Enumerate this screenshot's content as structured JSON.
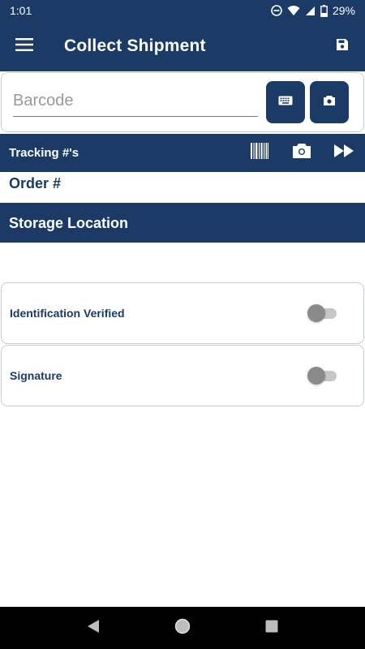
{
  "status_bar": {
    "time": "1:01",
    "battery": "29%",
    "icons": [
      "do-not-disturb-icon",
      "wifi-icon",
      "cell-signal-icon",
      "battery-icon"
    ]
  },
  "app_bar": {
    "title": "Collect Shipment",
    "menu_icon": "hamburger-menu-icon",
    "save_icon": "save-icon"
  },
  "barcode": {
    "placeholder": "Barcode",
    "value": "",
    "keyboard_icon": "keyboard-icon",
    "camera_icon": "camera-icon"
  },
  "tracking": {
    "label": "Tracking #'s",
    "icons": [
      "barcode-icon",
      "camera-icon",
      "fast-forward-icon"
    ]
  },
  "order": {
    "label": "Order #"
  },
  "storage": {
    "label": "Storage Location"
  },
  "toggles": {
    "identification": {
      "label": "Identification Verified",
      "checked": false
    },
    "signature": {
      "label": "Signature",
      "checked": false
    }
  },
  "nav": {
    "icons": [
      "back-icon",
      "home-icon",
      "recents-icon"
    ]
  },
  "colors": {
    "primary": "#1b3a66",
    "card_border": "#c8ccd2",
    "switch_thumb_off": "#8a8a8a",
    "switch_track_off": "#c6c6c6"
  }
}
